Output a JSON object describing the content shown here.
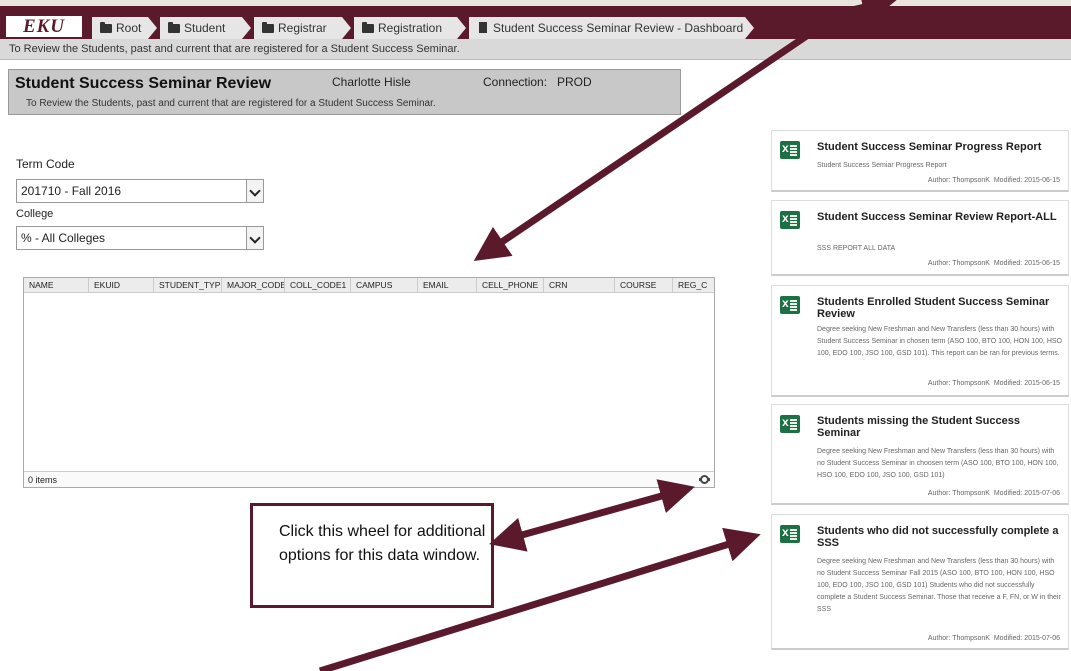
{
  "app": {
    "logo": "EKU"
  },
  "breadcrumbs": [
    {
      "label": "Root"
    },
    {
      "label": "Student"
    },
    {
      "label": "Registrar"
    },
    {
      "label": "Registration"
    },
    {
      "label": "Student Success Seminar Review - Dashboard"
    }
  ],
  "subheader": "To Review the Students, past and current that are registered for a Student Success Seminar.",
  "header": {
    "title": "Student Success Seminar Review",
    "user": "Charlotte Hisle",
    "connection_label": "Connection:",
    "connection": "PROD",
    "description": "To Review the Students, past and current that are registered for a Student Success Seminar."
  },
  "filters": {
    "term_label": "Term Code",
    "term_value": "201710 - Fall 2016",
    "college_label": "College",
    "college_value": "% - All Colleges"
  },
  "grid": {
    "columns": [
      "NAME",
      "EKUID",
      "STUDENT_TYPE",
      "MAJOR_CODE",
      "COLL_CODE1",
      "CAMPUS",
      "EMAIL",
      "CELL_PHONE",
      "CRN",
      "COURSE",
      "REG_C"
    ],
    "rows": [],
    "footer": "0 items"
  },
  "reports": [
    {
      "title": "Student Success Seminar Progress Report",
      "description": "Student Success Semiar Progress Report",
      "author": "Author: ThompsonK",
      "modified": "Modified: 2015-06-15"
    },
    {
      "title": "Student Success Seminar Review Report-ALL",
      "description": "SSS REPORT ALL DATA",
      "author": "Author: ThompsonK",
      "modified": "Modified: 2015-06-15"
    },
    {
      "title": "Students Enrolled Student Success Seminar Review",
      "description": "Degree seeking New Freshman and New Transfers (less than 30 hours) with Student Success Seminar in chosen term (ASO 100, BTO 100, HON 100, HSO 100, EDO 100, JSO 100, GSD 101). This report can be ran for previous terms.",
      "author": "Author: ThompsonK",
      "modified": "Modified: 2015-06-15"
    },
    {
      "title": "Students missing the Student Success Seminar",
      "description": "Degree seeking New Freshman and New Transfers (less than 30 hours) with no Student Success Seminar in choosen term (ASO 100, BTO 100, HON 100, HSO 100, EDO 100, JSO 100, GSD 101)",
      "author": "Author: ThompsonK",
      "modified": "Modified: 2015-07-06"
    },
    {
      "title": "Students who did not successfully complete a SSS",
      "description": "Degree seeking New Freshman and New Transfers (less than 30 hours) with no Student Success Seminar Fall 2015 (ASO 100, BTO 100, HON 100, HSO 100, EDO 100, JSO 100, GSD 101) Students who did not successfully complete a Student Success Seminar. Those that receive a F, FN, or W in their SSS",
      "author": "Author: ThompsonK",
      "modified": "Modified: 2015-07-06"
    }
  ],
  "callout": {
    "text": "Click this wheel for additional options for this data window."
  },
  "colors": {
    "brand": "#5a1a2c",
    "excel": "#1d7044",
    "header_bg": "#c8c8c8"
  },
  "icons": [
    "folder-icon",
    "document-icon",
    "excel-icon",
    "gear-icon",
    "dropdown-arrow-icon"
  ]
}
